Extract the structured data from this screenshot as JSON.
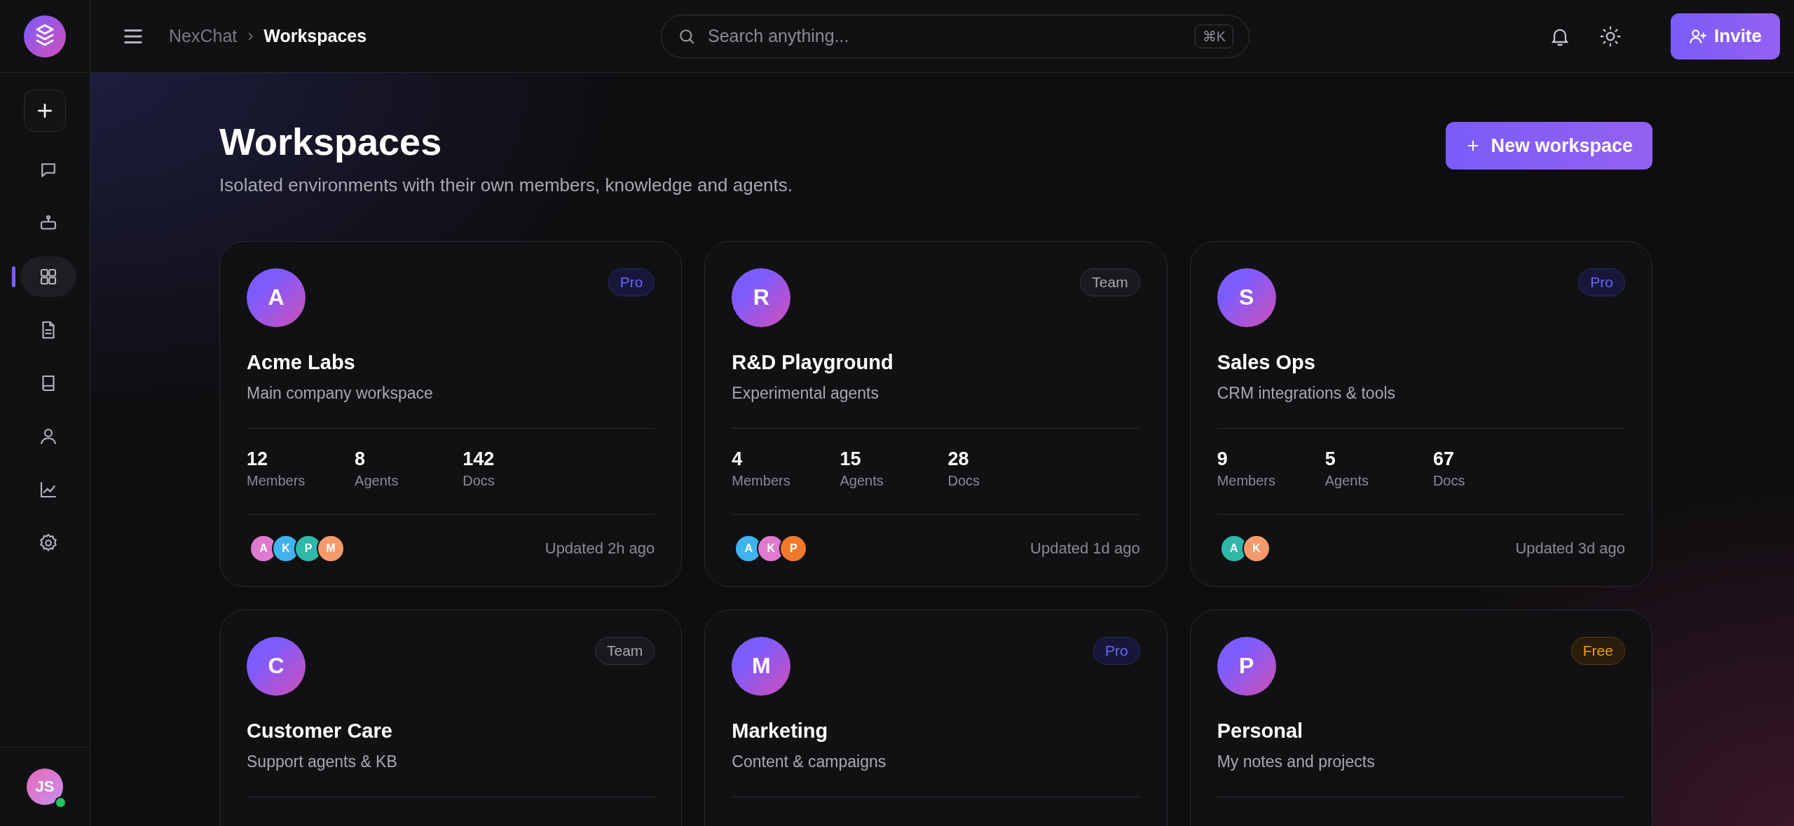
{
  "topbar": {
    "breadcrumb": [
      "NexChat",
      "Workspaces"
    ],
    "search": {
      "placeholder": "Search anything...",
      "shortcut": "⌘K"
    },
    "invite_button": "Invite"
  },
  "sidebar": {
    "items": [
      {
        "kind": "chat",
        "selected": false
      },
      {
        "kind": "bot",
        "selected": false
      },
      {
        "kind": "grid",
        "selected": true
      },
      {
        "kind": "doc",
        "selected": false
      },
      {
        "kind": "book",
        "selected": false
      },
      {
        "kind": "user",
        "selected": false
      },
      {
        "kind": "chart",
        "selected": false
      },
      {
        "kind": "settings",
        "selected": false
      }
    ],
    "user": {
      "initials": "JS",
      "online": true
    }
  },
  "page": {
    "title": "Workspaces",
    "subtitle": "Isolated environments with their own members, knowledge and agents.",
    "new_button": "New workspace"
  },
  "workspaces": [
    {
      "initial": "A",
      "name": "Acme Labs",
      "description": "Main company workspace",
      "plan": {
        "label": "Pro",
        "kind": "pro"
      },
      "stats": [
        {
          "value": "12",
          "label": "Members"
        },
        {
          "value": "8",
          "label": "Agents"
        },
        {
          "value": "142",
          "label": "Docs"
        }
      ],
      "members": [
        {
          "initial": "A",
          "color": "#e07ad0"
        },
        {
          "initial": "K",
          "color": "#3fb3ee"
        },
        {
          "initial": "P",
          "color": "#2fb8a8"
        },
        {
          "initial": "M",
          "color": "#f59a6a"
        }
      ],
      "updated": "Updated 2h ago"
    },
    {
      "initial": "R",
      "name": "R&D Playground",
      "description": "Experimental agents",
      "plan": {
        "label": "Team",
        "kind": "team"
      },
      "stats": [
        {
          "value": "4",
          "label": "Members"
        },
        {
          "value": "15",
          "label": "Agents"
        },
        {
          "value": "28",
          "label": "Docs"
        }
      ],
      "members": [
        {
          "initial": "A",
          "color": "#3fb3ee"
        },
        {
          "initial": "K",
          "color": "#e07ad0"
        },
        {
          "initial": "P",
          "color": "#f07a2a"
        }
      ],
      "updated": "Updated 1d ago"
    },
    {
      "initial": "S",
      "name": "Sales Ops",
      "description": "CRM integrations & tools",
      "plan": {
        "label": "Pro",
        "kind": "pro"
      },
      "stats": [
        {
          "value": "9",
          "label": "Members"
        },
        {
          "value": "5",
          "label": "Agents"
        },
        {
          "value": "67",
          "label": "Docs"
        }
      ],
      "members": [
        {
          "initial": "A",
          "color": "#2fb8a8"
        },
        {
          "initial": "K",
          "color": "#f59a6a"
        }
      ],
      "updated": "Updated 3d ago"
    },
    {
      "initial": "C",
      "name": "Customer Care",
      "description": "Support agents & KB",
      "plan": {
        "label": "Team",
        "kind": "team"
      }
    },
    {
      "initial": "M",
      "name": "Marketing",
      "description": "Content & campaigns",
      "plan": {
        "label": "Pro",
        "kind": "pro"
      }
    },
    {
      "initial": "P",
      "name": "Personal",
      "description": "My notes and projects",
      "plan": {
        "label": "Free",
        "kind": "free"
      }
    }
  ]
}
